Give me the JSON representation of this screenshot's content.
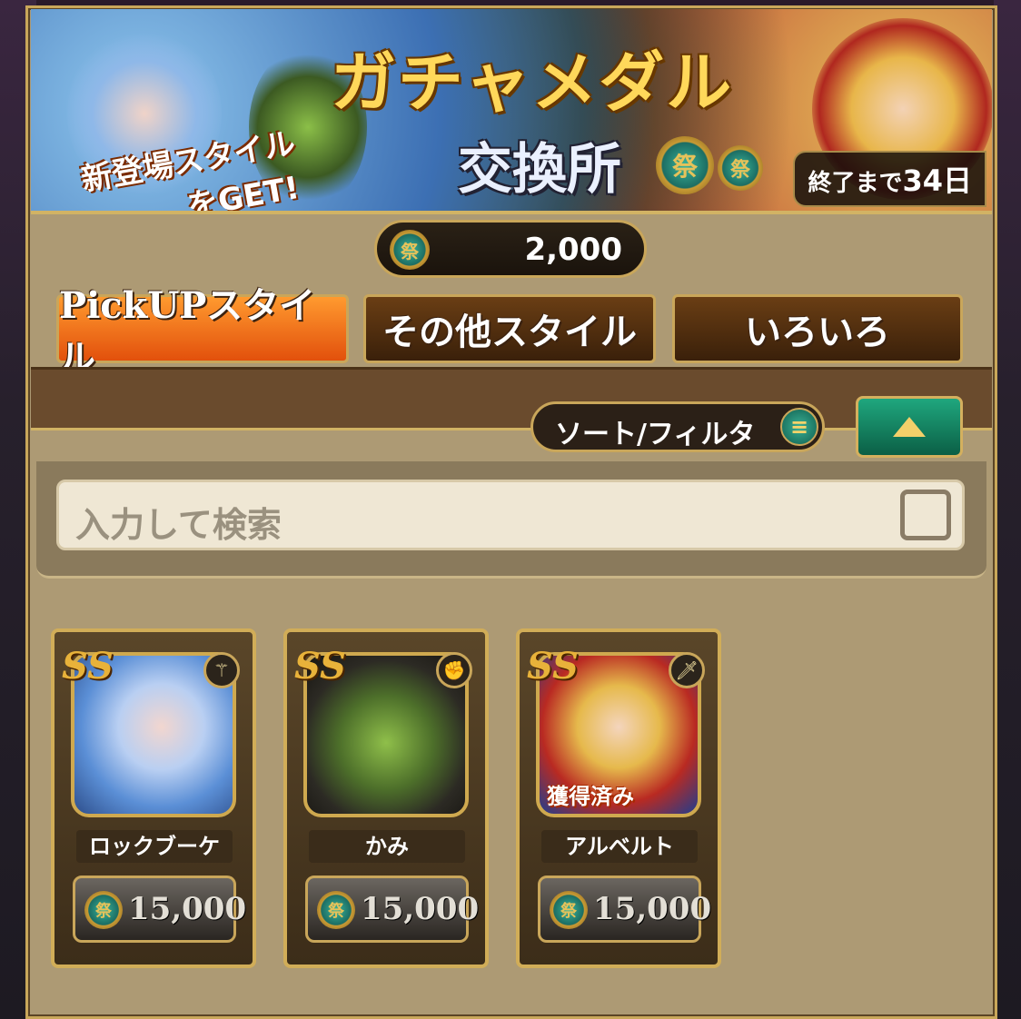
{
  "banner": {
    "title": "ガチャメダル",
    "subtitle": "交換所",
    "tagline_line1": "新登場スタイル",
    "tagline_line2": "をGET!",
    "medal_glyph": "祭",
    "deadline": "終了まで",
    "deadline_days": "34日"
  },
  "currency": {
    "icon": "gacha-medal-icon",
    "amount": "2,000"
  },
  "tabs": [
    {
      "label": "PickUPスタイル",
      "active": true
    },
    {
      "label": "その他スタイル",
      "active": false
    },
    {
      "label": "いろいろ",
      "active": false
    }
  ],
  "filter": {
    "sort_label": "ソート/フィルタ",
    "search_placeholder": "入力して検索"
  },
  "cards": [
    {
      "rank": "SS",
      "name": "ロックブーケ",
      "price": "15,000",
      "weapon_icon": "staff-icon",
      "owned": false
    },
    {
      "rank": "SS",
      "name": "かみ",
      "price": "15,000",
      "weapon_icon": "fist-icon",
      "owned": false
    },
    {
      "rank": "SS",
      "name": "アルベルト",
      "price": "15,000",
      "weapon_icon": "sword-icon",
      "owned": true,
      "owned_label": "獲得済み"
    }
  ],
  "colors": {
    "tab_active": "#e2500c",
    "tab_inactive": "#3a200a",
    "gold_border": "#c9a65a",
    "panel": "#ad9a74"
  }
}
